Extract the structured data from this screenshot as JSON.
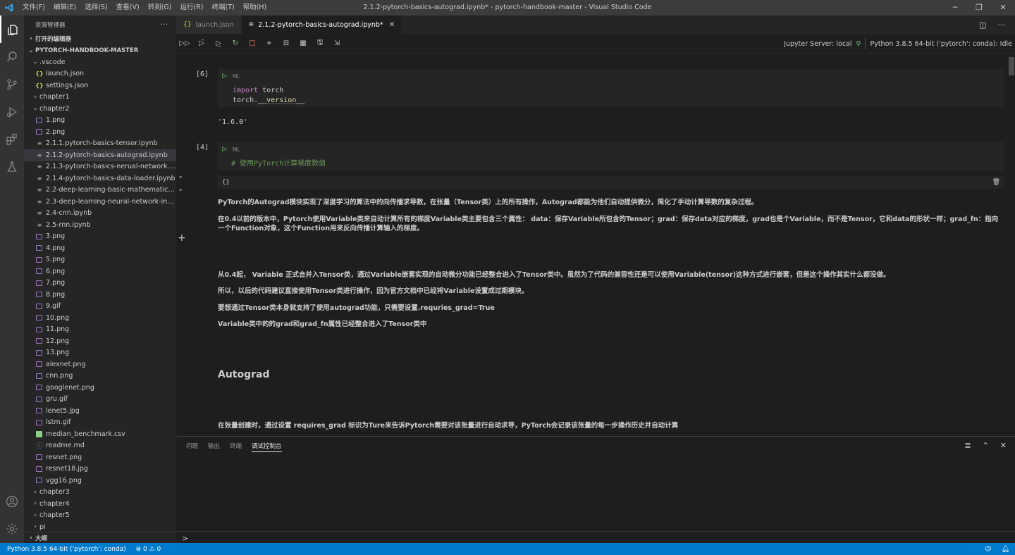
{
  "titlebar": {
    "menu": [
      "文件(F)",
      "编辑(E)",
      "选择(S)",
      "查看(V)",
      "转到(G)",
      "运行(R)",
      "终端(T)",
      "帮助(H)"
    ],
    "title": "2.1.2-pytorch-basics-autograd.ipynb* - pytorch-handbook-master - Visual Studio Code"
  },
  "sidebar": {
    "header": "资源管理器",
    "open_editors": "打开的编辑器",
    "root": "PYTORCH-HANDBOOK-MASTER",
    "outline": "大纲",
    "tree": [
      {
        "label": ".vscode",
        "type": "folder-open",
        "indent": 1
      },
      {
        "label": "launch.json",
        "type": "json",
        "indent": 2
      },
      {
        "label": "settings.json",
        "type": "json",
        "indent": 2
      },
      {
        "label": "chapter1",
        "type": "folder",
        "indent": 1
      },
      {
        "label": "chapter2",
        "type": "folder-open",
        "indent": 1
      },
      {
        "label": "1.png",
        "type": "png",
        "indent": 2
      },
      {
        "label": "2.png",
        "type": "png",
        "indent": 2
      },
      {
        "label": "2.1.1.pytorch-basics-tensor.ipynb",
        "type": "nb",
        "indent": 2
      },
      {
        "label": "2.1.2-pytorch-basics-autograd.ipynb",
        "type": "nb",
        "indent": 2,
        "selected": true
      },
      {
        "label": "2.1.3-pytorch-basics-nerual-network.ipynb",
        "type": "nb",
        "indent": 2
      },
      {
        "label": "2.1.4-pytorch-basics-data-loader.ipynb",
        "type": "nb",
        "indent": 2
      },
      {
        "label": "2.2-deep-learning-basic-mathematics.ip...",
        "type": "nb",
        "indent": 2
      },
      {
        "label": "2.3-deep-learning-neural-network-intro...",
        "type": "nb",
        "indent": 2
      },
      {
        "label": "2.4-cnn.ipynb",
        "type": "nb",
        "indent": 2
      },
      {
        "label": "2.5-rnn.ipynb",
        "type": "nb",
        "indent": 2
      },
      {
        "label": "3.png",
        "type": "png",
        "indent": 2
      },
      {
        "label": "4.png",
        "type": "png",
        "indent": 2
      },
      {
        "label": "5.png",
        "type": "png",
        "indent": 2
      },
      {
        "label": "6.png",
        "type": "png",
        "indent": 2
      },
      {
        "label": "7.png",
        "type": "png",
        "indent": 2
      },
      {
        "label": "8.png",
        "type": "png",
        "indent": 2
      },
      {
        "label": "9.gif",
        "type": "png",
        "indent": 2
      },
      {
        "label": "10.png",
        "type": "png",
        "indent": 2
      },
      {
        "label": "11.png",
        "type": "png",
        "indent": 2
      },
      {
        "label": "12.png",
        "type": "png",
        "indent": 2
      },
      {
        "label": "13.png",
        "type": "png",
        "indent": 2
      },
      {
        "label": "alexnet.png",
        "type": "png",
        "indent": 2
      },
      {
        "label": "cnn.png",
        "type": "png",
        "indent": 2
      },
      {
        "label": "googlenet.png",
        "type": "png",
        "indent": 2
      },
      {
        "label": "gru.gif",
        "type": "png",
        "indent": 2
      },
      {
        "label": "lenet5.jpg",
        "type": "png",
        "indent": 2
      },
      {
        "label": "lstm.gif",
        "type": "png",
        "indent": 2
      },
      {
        "label": "median_benchmark.csv",
        "type": "csv",
        "indent": 2
      },
      {
        "label": "readme.md",
        "type": "md",
        "indent": 2
      },
      {
        "label": "resnet.png",
        "type": "png",
        "indent": 2
      },
      {
        "label": "resnet18.jpg",
        "type": "png",
        "indent": 2
      },
      {
        "label": "vgg16.png",
        "type": "png",
        "indent": 2
      },
      {
        "label": "chapter3",
        "type": "folder",
        "indent": 1
      },
      {
        "label": "chapter4",
        "type": "folder",
        "indent": 1
      },
      {
        "label": "chapter5",
        "type": "folder",
        "indent": 1
      },
      {
        "label": "pi",
        "type": "folder",
        "indent": 1
      }
    ]
  },
  "tabs": [
    {
      "label": "launch.json",
      "icon": "{}",
      "active": false
    },
    {
      "label": "2.1.2-pytorch-basics-autograd.ipynb*",
      "icon": "≡",
      "active": true
    }
  ],
  "toolbar": {
    "jupyter_server": "Jupyter Server: local",
    "kernel": "Python 3.8.5 64-bit ('pytorch': conda): Idle"
  },
  "notebook": {
    "cell1": {
      "num": "[6]",
      "lang": "ML",
      "code_kw": "import",
      "code_mod": " torch",
      "code2_obj": "torch.",
      "code2_attr": "__version__",
      "output": "'1.6.0'"
    },
    "cell2": {
      "num": "[4]",
      "lang": "ML",
      "comment": "# 使用PyTorch计算梯度数值"
    },
    "md_bar_label": "{}",
    "p1": "PyTorch的Autograd模块实现了深度学习的算法中的向传播求导数，在张量（Tensor类）上的所有操作，Autograd都能为他们自动提供微分，简化了手动计算导数的复杂过程。",
    "p2": "在0.4以前的版本中，Pytorch使用Variable类来自动计算所有的梯度Variable类主要包含三个属性： data：保存Variable所包含的Tensor；grad：保存data对应的梯度，grad也是个Variable，而不是Tensor，它和data的形状一样；grad_fn：指向一个Function对象，这个Function用来反向传播计算输入的梯度。",
    "p3": "从0.4起， Variable 正式合并入Tensor类，通过Variable嵌套实现的自动微分功能已经整合进入了Tensor类中。虽然为了代码的兼容性还是可以使用Variable(tensor)这种方式进行嵌套，但是这个操作其实什么都没做。",
    "p4": "所以，以后的代码建议直接使用Tensor类进行操作，因为官方文档中已经将Variable设置成过期模块。",
    "p5": "要想通过Tensor类本身就支持了使用autograd功能，只需要设置.requries_grad=True",
    "p6": "Variable类中的的grad和grad_fn属性已经整合进入了Tensor类中",
    "h1": "Autograd",
    "p7": "在张量创建时，通过设置 requires_grad 标识为Ture来告诉Pytorch需要对该张量进行自动求导，PyTorch会记录该张量的每一步操作历史并自动计算"
  },
  "panel": {
    "tabs": [
      "问题",
      "输出",
      "终端",
      "调试控制台"
    ],
    "active_tab": "调试控制台",
    "prompt": ">"
  },
  "status": {
    "interpreter": "Python 3.8.5 64-bit ('pytorch': conda)",
    "errors": "⊗ 0 ⚠ 0"
  }
}
